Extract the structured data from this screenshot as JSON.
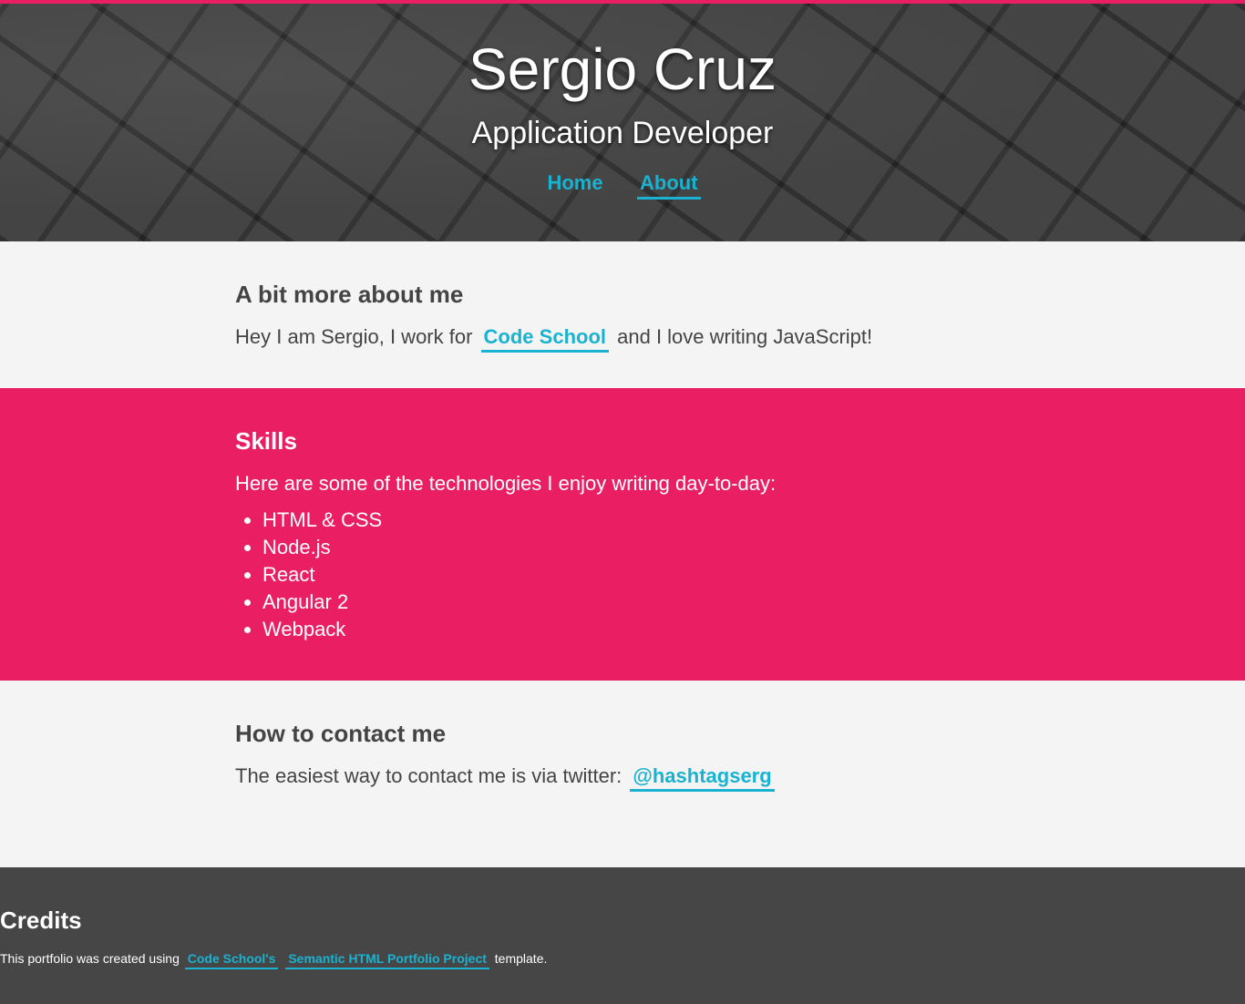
{
  "header": {
    "name": "Sergio Cruz",
    "tagline": "Application Developer",
    "nav": [
      {
        "label": "Home",
        "active": false
      },
      {
        "label": "About",
        "active": true
      }
    ]
  },
  "about": {
    "title": "A bit more about me",
    "text_before": "Hey I am Sergio, I work for",
    "link": "Code School",
    "text_after": "and I love writing JavaScript!"
  },
  "skills": {
    "title": "Skills",
    "intro": "Here are some of the technologies I enjoy writing day-to-day:",
    "items": [
      "HTML & CSS",
      "Node.js",
      "React",
      "Angular 2",
      "Webpack"
    ]
  },
  "contact": {
    "title": "How to contact me",
    "text": "The easiest way to contact me is via twitter:",
    "link": "@hashtagserg"
  },
  "credits": {
    "title": "Credits",
    "text_before": "This portfolio was created using",
    "link1": "Code School's",
    "link2": "Semantic HTML Portfolio Project",
    "text_after": "template."
  },
  "colors": {
    "accent_pink": "#e91e63",
    "link_cyan": "#19b3d1",
    "footer_bg": "#464646",
    "section_bg": "#f4f4f4"
  }
}
